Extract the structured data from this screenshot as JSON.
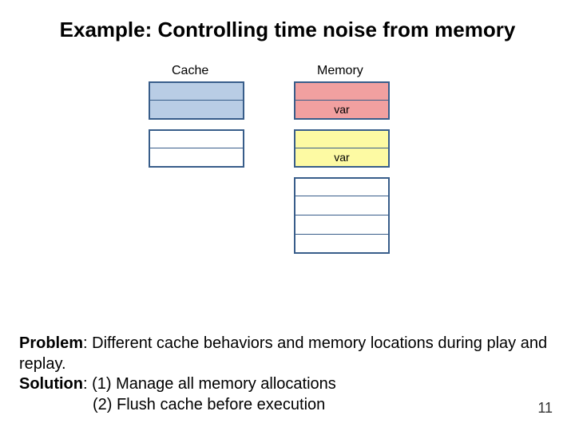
{
  "title": "Example: Controlling time noise from memory",
  "labels": {
    "cache": "Cache",
    "memory": "Memory"
  },
  "cache_cells": [
    "",
    "",
    "",
    ""
  ],
  "memory_cells": [
    "",
    "var",
    "",
    "var",
    "",
    "",
    "",
    ""
  ],
  "problem_label": "Problem",
  "problem_text": ": Different cache behaviors and memory locations during play and replay.",
  "solution_label": "Solution",
  "solution_1": ": (1) Manage all memory allocations",
  "solution_2": "(2) Flush cache before execution",
  "page": "11",
  "chart_data": {
    "type": "table",
    "title": "Cache vs Memory layout illustration",
    "cache": {
      "groups": [
        {
          "color": "blue",
          "rows": [
            "",
            ""
          ]
        },
        {
          "color": "white",
          "rows": [
            "",
            ""
          ]
        }
      ]
    },
    "memory": {
      "groups": [
        {
          "color": "red",
          "rows": [
            "",
            "var"
          ]
        },
        {
          "color": "yellow",
          "rows": [
            "",
            "var"
          ]
        },
        {
          "color": "white",
          "rows": [
            "",
            "",
            "",
            ""
          ]
        }
      ]
    }
  }
}
